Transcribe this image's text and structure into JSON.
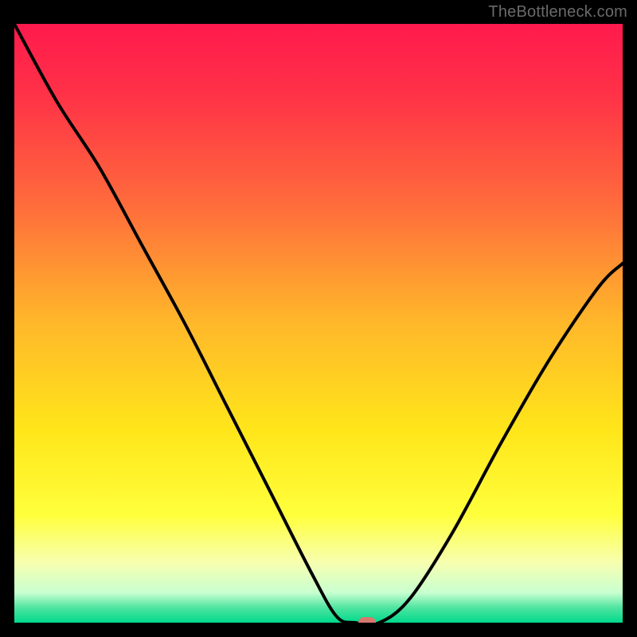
{
  "watermark": "TheBottleneck.com",
  "chart_data": {
    "type": "line",
    "title": "",
    "xlabel": "",
    "ylabel": "",
    "xlim": [
      0,
      1
    ],
    "ylim": [
      0,
      1
    ],
    "series": [
      {
        "name": "curve",
        "x": [
          0.0,
          0.07,
          0.14,
          0.21,
          0.28,
          0.35,
          0.42,
          0.49,
          0.53,
          0.56,
          0.6,
          0.65,
          0.72,
          0.8,
          0.88,
          0.96,
          1.0
        ],
        "values": [
          1.0,
          0.87,
          0.76,
          0.63,
          0.5,
          0.36,
          0.22,
          0.08,
          0.01,
          0.0,
          0.0,
          0.04,
          0.15,
          0.3,
          0.44,
          0.56,
          0.6
        ]
      }
    ],
    "marker": {
      "x": 0.58,
      "y": 0.0
    },
    "background_gradient": {
      "stops": [
        {
          "offset": 0.0,
          "color": "#ff1a4d"
        },
        {
          "offset": 0.12,
          "color": "#ff3247"
        },
        {
          "offset": 0.3,
          "color": "#ff6b3c"
        },
        {
          "offset": 0.5,
          "color": "#ffb82a"
        },
        {
          "offset": 0.68,
          "color": "#ffe61a"
        },
        {
          "offset": 0.82,
          "color": "#ffff3c"
        },
        {
          "offset": 0.9,
          "color": "#f7ffb0"
        },
        {
          "offset": 0.95,
          "color": "#c8ffd0"
        },
        {
          "offset": 0.975,
          "color": "#4fe4a0"
        },
        {
          "offset": 1.0,
          "color": "#00d98c"
        }
      ]
    }
  }
}
